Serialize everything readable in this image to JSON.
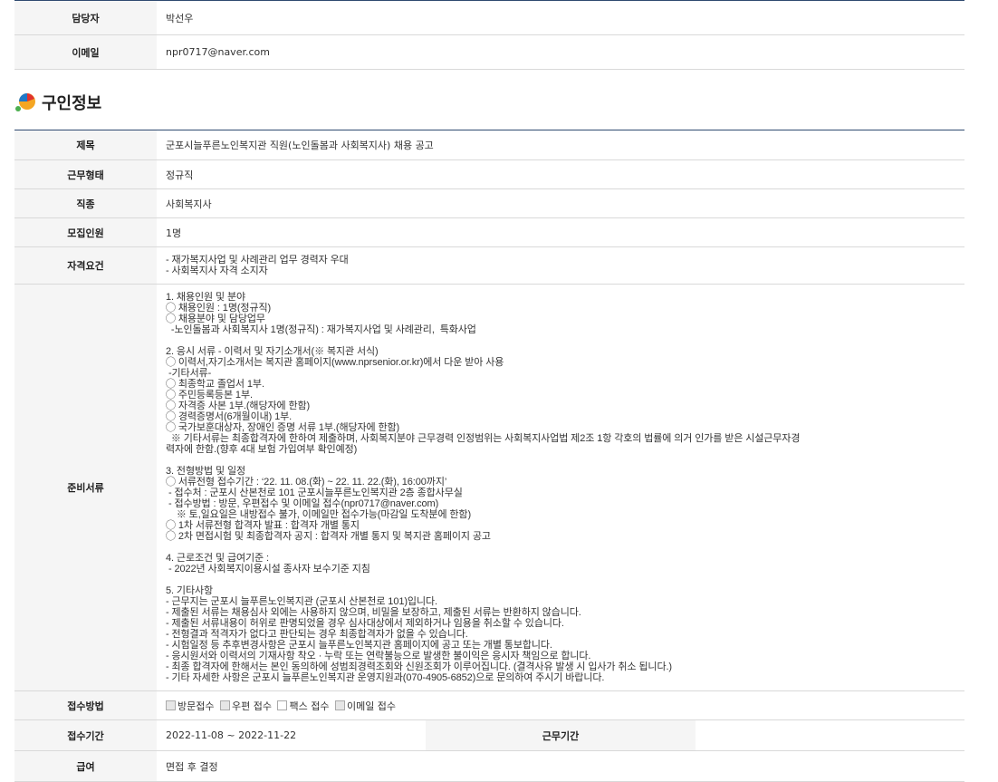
{
  "contact": {
    "manager_label": "담당자",
    "manager_value": "박선우",
    "email_label": "이메일",
    "email_value": "npr0717@naver.com"
  },
  "section": {
    "title": "구인정보"
  },
  "job": {
    "title_label": "제목",
    "title_value": "군포시늘푸른노인복지관 직원(노인돌봄과 사회복지사) 채용 공고",
    "type_label": "근무형태",
    "type_value": "정규직",
    "occupation_label": "직종",
    "occupation_value": "사회복지사",
    "count_label": "모집인원",
    "count_value": "1명",
    "qual_label": "자격요건",
    "qual_value": "- 재가복지사업 및 사례관리 업무 경력자 우대\n- 사회복지사 자격 소지자",
    "docs_label": "준비서류",
    "docs_value": "1. 채용인원 및 분야\n◯ 채용인원 : 1명(정규직)\n◯ 채용분야 및 담당업무\n  -노인돌봄과 사회복지사 1명(정규직) : 재가복지사업 및 사례관리,  특화사업\n\n2. 응시 서류 - 이력서 및 자기소개서(※ 복지관 서식)\n◯ 이력서,자기소개서는 복지관 홈페이지(www.nprsenior.or.kr)에서 다운 받아 사용\n -기타서류-\n◯ 최종학교 졸업서 1부.\n◯ 주민등록등본 1부.\n◯ 자격증 사본 1부.(해당자에 한함)\n◯ 경력증명서(6개월이내) 1부.\n◯ 국가보훈대상자, 장애인 증명 서류 1부.(해당자에 한함)\n  ※ 기타서류는 최종합격자에 한하여 제출하며, 사회복지분야 근무경력 인정범위는 사회복지사업법 제2조 1항 각호의 법률에 의거 인가를 받은 시설근무자경\n력자에 한함.(향후 4대 보험 가입여부 확인예정)\n\n3. 전형방법 및 일정\n◯ 서류전형 접수기간 : ‘22. 11. 08.(화) ~ 22. 11. 22.(화), 16:00까지’\n - 접수처 : 군포시 산본천로 101 군포시늘푸른노인복지관 2층 종합사무실\n - 접수방법 : 방문, 우편접수 및 이메일 접수(npr0717@naver.com)\n    ※ 토,일요일은 내방접수 불가, 이메일만 접수가능(마감일 도착분에 한함)\n◯ 1차 서류전형 합격자 발표 : 합격자 개별 통지\n◯ 2차 면접시험 및 최종합격자 공지 : 합격자 개별 통지 및 복지관 홈페이지 공고\n\n4. 근로조건 및 급여기준 :\n - 2022년 사회복지이용시설 종사자 보수기준 지침\n\n5. 기타사항\n- 근무지는 군포시 늘푸른노인복지관 (군포시 산본천로 101)입니다.\n- 제출된 서류는 채용심사 외에는 사용하지 않으며, 비밀을 보장하고, 제출된 서류는 반환하지 않습니다.\n- 제출된 서류내용이 허위로 판명되었을 경우 심사대상에서 제외하거나 임용을 취소할 수 있습니다.\n- 전형결과 적격자가 없다고 판단되는 경우 최종합격자가 없을 수 있습니다.\n- 시험일정 등 추후변경사항은 군포시 늘푸른노인복지관 홈페이지에 공고 또는 개별 통보합니다.\n- 응시원서와 이력서의 기재사항 착오 · 누락 또는 연락불능으로 발생한 불이익은 응시자 책임으로 합니다.\n- 최종 합격자에 한해서는 본인 동의하에 성범죄경력조회와 신원조회가 이루어집니다. (결격사유 발생 시 입사가 취소 됩니다.)\n- 기타 자세한 사항은 군포시 늘푸른노인복지관 운영지원과(070-4905-6852)으로 문의하여 주시기 바랍니다.",
    "method_label": "접수방법",
    "methods": [
      {
        "label": "방문접수",
        "checked": true
      },
      {
        "label": "우편 접수",
        "checked": true
      },
      {
        "label": "팩스 접수",
        "checked": false
      },
      {
        "label": "이메일 접수",
        "checked": true
      }
    ],
    "period_label": "접수기간",
    "period_value": "2022-11-08 ~ 2022-11-22",
    "work_period_label": "근무기간",
    "work_period_value": "",
    "salary_label": "급여",
    "salary_value": "면접 후 결정"
  }
}
